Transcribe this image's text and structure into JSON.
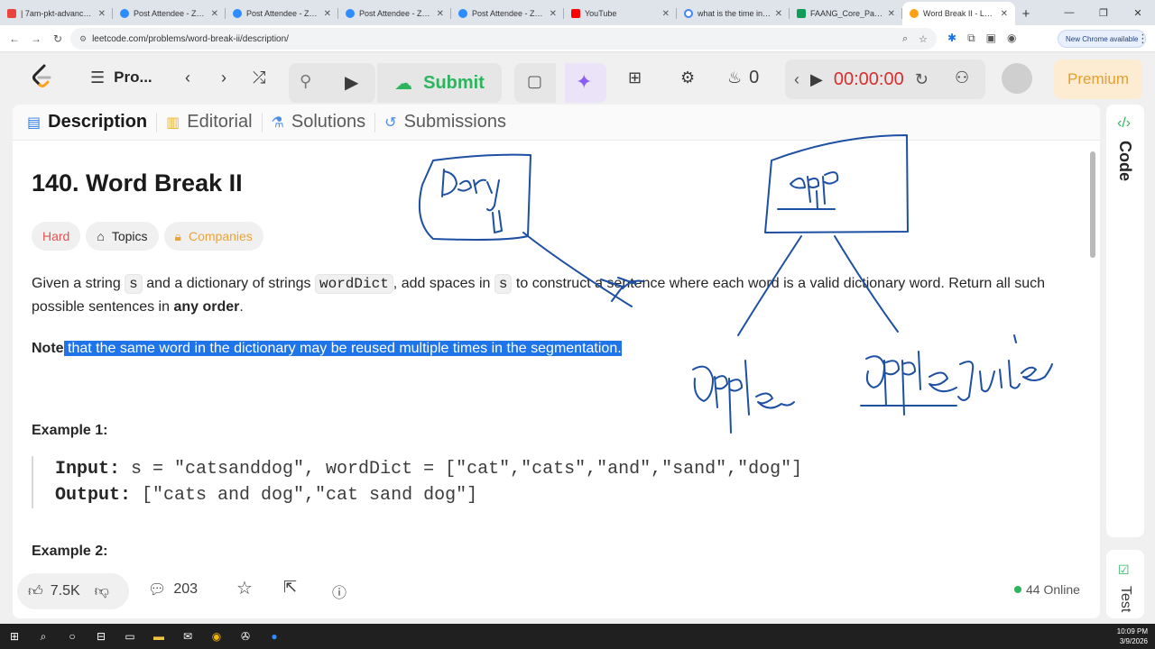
{
  "browser": {
    "tabs": [
      {
        "title": "| 7am-pkt-advanced-",
        "color": "#e8453c"
      },
      {
        "title": "Post Attendee - Zoom",
        "color": "#2d8cff"
      },
      {
        "title": "Post Attendee - Zoom",
        "color": "#2d8cff"
      },
      {
        "title": "Post Attendee - Zoom",
        "color": "#2d8cff"
      },
      {
        "title": "Post Attendee - Zoom",
        "color": "#2d8cff"
      },
      {
        "title": "YouTube",
        "color": "#ff0000"
      },
      {
        "title": "what is the time in Pa",
        "color": "#4285f4"
      },
      {
        "title": "FAANG_Core_Patterns",
        "color": "#0f9d58"
      },
      {
        "title": "Word Break II - LeetC",
        "color": "#ffa116"
      }
    ],
    "url": "leetcode.com/problems/word-break-ii/description/",
    "new_chrome_label": "New Chrome available"
  },
  "leetcode_nav": {
    "problem_list_label": "Pro...",
    "submit_label": "Submit",
    "streak_count": "0",
    "timer": "00:00:00",
    "premium_label": "Premium"
  },
  "panel_tabs": [
    {
      "label": "Description"
    },
    {
      "label": "Editorial"
    },
    {
      "label": "Solutions"
    },
    {
      "label": "Submissions"
    }
  ],
  "problem": {
    "title": "140. Word Break II",
    "difficulty": "Hard",
    "topics_label": "Topics",
    "companies_label": "Companies",
    "desc_1": "Given a string ",
    "code_s": "s",
    "desc_2": " and a dictionary of strings ",
    "code_worddict": "wordDict",
    "desc_3": ", add spaces in ",
    "desc_4": " to construct a sentence where each word is a valid dictionary word. Return all such possible sentences in ",
    "desc_bold": "any order",
    "desc_end": ".",
    "note_bold": "Note",
    "note_text": " that the same word in the dictionary may be reused multiple times in the segmentation.",
    "example1_label": "Example 1:",
    "input_label": "Input:",
    "input_value": " s = \"catsanddog\", wordDict = [\"cat\",\"cats\",\"and\",\"sand\",\"dog\"]",
    "output_label": "Output:",
    "output_value": " [\"cats and dog\",\"cat sand dog\"]",
    "example2_label": "Example 2:"
  },
  "bottom_bar": {
    "likes": "7.5K",
    "comments": "203",
    "online": "44 Online"
  },
  "right_panel": {
    "code_label": "Code",
    "test_label": "Test"
  },
  "taskbar": {
    "time": "10:09 PM",
    "date": "3/9/2026"
  }
}
